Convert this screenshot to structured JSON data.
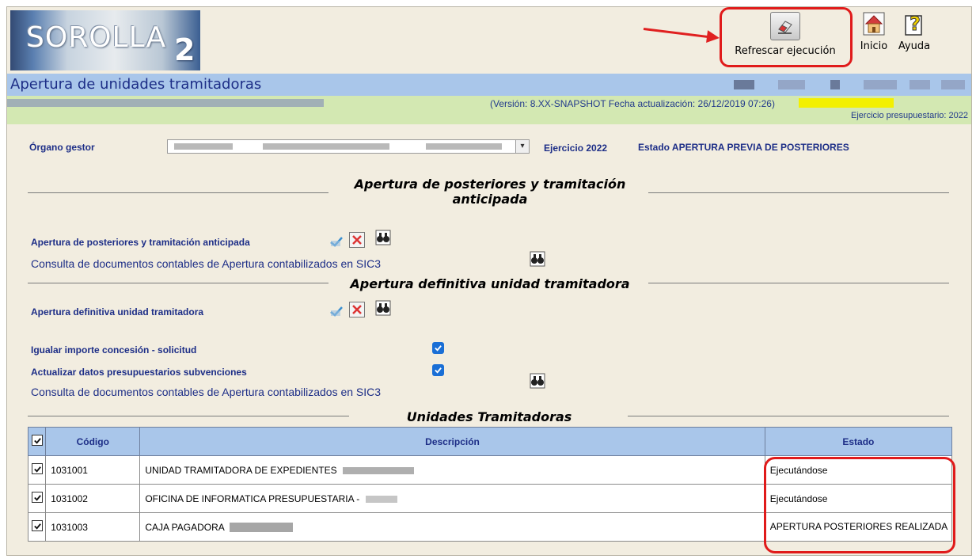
{
  "header": {
    "logo_text": "SOROLLA",
    "logo_sub": "2",
    "toolbar": {
      "refresh_label": "Refrescar ejecución",
      "inicio_label": "Inicio",
      "ayuda_label": "Ayuda"
    }
  },
  "titlebar": {
    "page_title": "Apertura de unidades tramitadoras",
    "version_line": "(Versión: 8.XX-SNAPSHOT Fecha actualización: 26/12/2019 07:26)",
    "ejercicio_presupuestario": "Ejercicio presupuestario: 2022"
  },
  "form": {
    "organo_label": "Órgano gestor",
    "ejercicio_label": "Ejercicio",
    "ejercicio_value": "2022",
    "estado_label": "Estado",
    "estado_value": "APERTURA PREVIA DE POSTERIORES"
  },
  "section1": {
    "title_line1": "Apertura de posteriores y tramitación",
    "title_line2": "anticipada",
    "row_label": "Apertura de posteriores y tramitación anticipada",
    "consulta_label": "Consulta de documentos contables de Apertura contabilizados en SIC3"
  },
  "section2": {
    "title": "Apertura definitiva unidad tramitadora",
    "row_label": "Apertura definitiva unidad tramitadora",
    "igualar_label": "Igualar importe concesión - solicitud",
    "actualizar_label": "Actualizar datos presupuestarios subvenciones",
    "consulta_label": "Consulta de documentos contables de Apertura contabilizados en SIC3"
  },
  "section3": {
    "title": "Unidades Tramitadoras"
  },
  "table": {
    "headers": {
      "codigo": "Código",
      "descripcion": "Descripción",
      "estado": "Estado"
    },
    "rows": [
      {
        "codigo": "1031001",
        "descripcion": "UNIDAD TRAMITADORA DE EXPEDIENTES",
        "estado": "Ejecutándose",
        "checked": true
      },
      {
        "codigo": "1031002",
        "descripcion": "OFICINA DE INFORMATICA PRESUPUESTARIA -",
        "estado": "Ejecutándose",
        "checked": true
      },
      {
        "codigo": "1031003",
        "descripcion": "CAJA PAGADORA",
        "estado": "APERTURA POSTERIORES REALIZADA",
        "checked": true
      }
    ]
  },
  "colors": {
    "title_bar": "#a9c6ea",
    "info_bar": "#d3e8b2",
    "background": "#f2ede0",
    "text_blue": "#1d2e87",
    "highlight_red": "#e01b1b"
  }
}
